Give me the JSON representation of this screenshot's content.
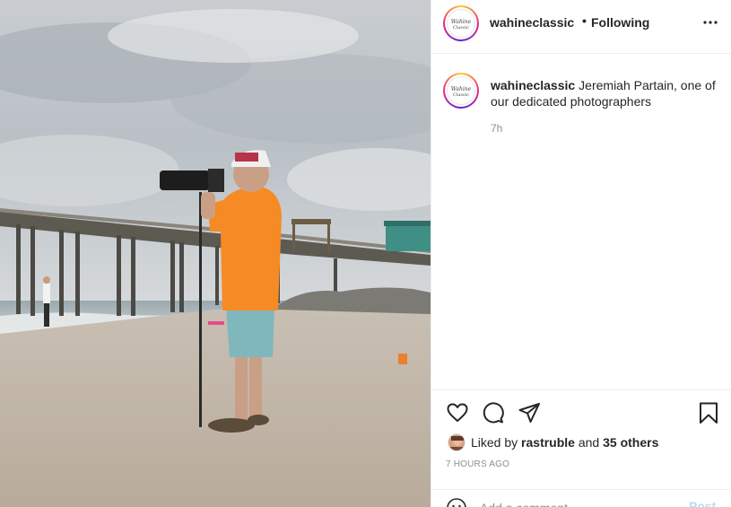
{
  "post": {
    "username": "wahineclassic",
    "follow_status": "Following",
    "separator": "•",
    "avatar_logo": "Wahine Classic",
    "caption": {
      "username": "wahineclassic",
      "text": "Jeremiah Partain, one of our dedicated photographers",
      "time": "7h"
    },
    "likes": {
      "prefix": "Liked by",
      "user": "rastruble",
      "conjunction": "and",
      "others": "35 others"
    },
    "age": "7 HOURS AGO",
    "comment": {
      "placeholder": "Add a comment…",
      "post_label": "Post"
    }
  },
  "icons": {
    "more": "more-options-icon",
    "like": "heart-icon",
    "comment": "comment-icon",
    "share": "share-icon",
    "save": "bookmark-icon",
    "emoji": "emoji-icon"
  },
  "colors": {
    "text": "#262626",
    "secondary": "#8e8e8e",
    "post_button_disabled": "#b2dffc",
    "divider": "#efefef"
  }
}
